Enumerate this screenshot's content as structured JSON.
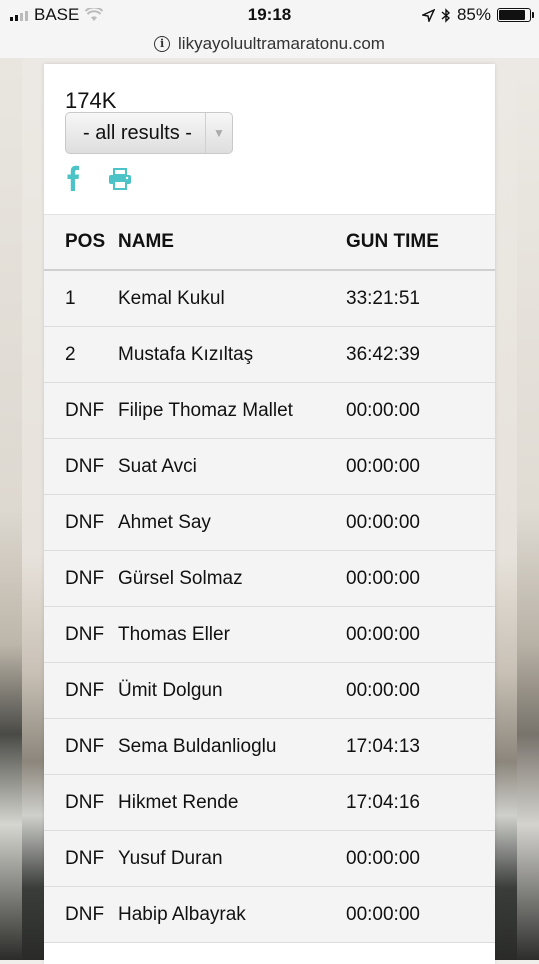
{
  "status_bar": {
    "carrier": "BASE",
    "time": "19:18",
    "battery": "85%"
  },
  "url_bar": {
    "url": "likyayoluultramaratonu.com"
  },
  "race": {
    "title": "174K",
    "filter_selected": "- all results -"
  },
  "icons": {
    "share": "facebook-icon",
    "print": "print-icon",
    "accent_color": "#4cc3c6"
  },
  "table": {
    "columns": [
      "POS",
      "NAME",
      "GUN TIME"
    ],
    "rows": [
      {
        "pos": "1",
        "name": "Kemal Kukul",
        "time": "33:21:51"
      },
      {
        "pos": "2",
        "name": "Mustafa Kızıltaş",
        "time": "36:42:39"
      },
      {
        "pos": "DNF",
        "name": "Filipe Thomaz Mallet",
        "time": "00:00:00"
      },
      {
        "pos": "DNF",
        "name": "Suat Avci",
        "time": "00:00:00"
      },
      {
        "pos": "DNF",
        "name": "Ahmet Say",
        "time": "00:00:00"
      },
      {
        "pos": "DNF",
        "name": "Gürsel Solmaz",
        "time": "00:00:00"
      },
      {
        "pos": "DNF",
        "name": "Thomas Eller",
        "time": "00:00:00"
      },
      {
        "pos": "DNF",
        "name": "Ümit Dolgun",
        "time": "00:00:00"
      },
      {
        "pos": "DNF",
        "name": "Sema Buldanlioglu",
        "time": "17:04:13"
      },
      {
        "pos": "DNF",
        "name": "Hikmet Rende",
        "time": "17:04:16"
      },
      {
        "pos": "DNF",
        "name": "Yusuf Duran",
        "time": "00:00:00"
      },
      {
        "pos": "DNF",
        "name": "Habip Albayrak",
        "time": "00:00:00"
      }
    ]
  }
}
